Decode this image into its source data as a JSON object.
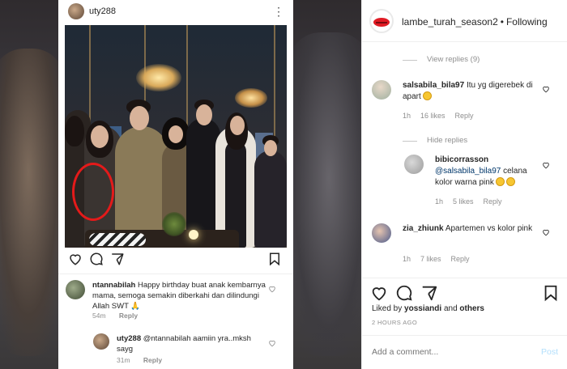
{
  "embed": {
    "username": "uty288",
    "comments": [
      {
        "user": "ntannabilah",
        "text": "Happy birthday buat anak kembarnya mama, semoga semakin diberkahi dan dilindungi Allah SWT 🙏",
        "time": "54m",
        "reply": "Reply"
      },
      {
        "user": "uty288",
        "text": "@ntannabilah aamiin yra..mksh sayg",
        "time": "31m",
        "reply": "Reply"
      }
    ]
  },
  "post": {
    "account": "lambe_turah_season2",
    "separator": "•",
    "follow_label": "Following",
    "view_replies": "View replies (9)",
    "comments": [
      {
        "user": "salsabila_bila97",
        "text": "Itu yg digerebek di apart",
        "time": "1h",
        "likes": "16 likes",
        "reply": "Reply"
      },
      {
        "user": "bibicorrasson",
        "mention": "@salsabila_bila97",
        "text": "celana kolor warna pink",
        "time": "1h",
        "likes": "5 likes",
        "reply": "Reply"
      },
      {
        "user": "zia_zhiunk",
        "text": "Apartemen vs kolor pink",
        "time": "1h",
        "likes": "7 likes",
        "reply": "Reply"
      }
    ],
    "hide_replies": "Hide replies",
    "liked_by_prefix": "Liked by",
    "liked_by_user": "yossiandi",
    "liked_by_and": "and",
    "liked_by_others": "others",
    "time_ago": "2 HOURS AGO",
    "comment_placeholder": "Add a comment...",
    "post_label": "Post"
  },
  "colors": {
    "accent": "#0095f6",
    "post_disabled": "#b2dffc",
    "annotation_circle": "#e41a1a",
    "logo_red": "#e01b24"
  }
}
